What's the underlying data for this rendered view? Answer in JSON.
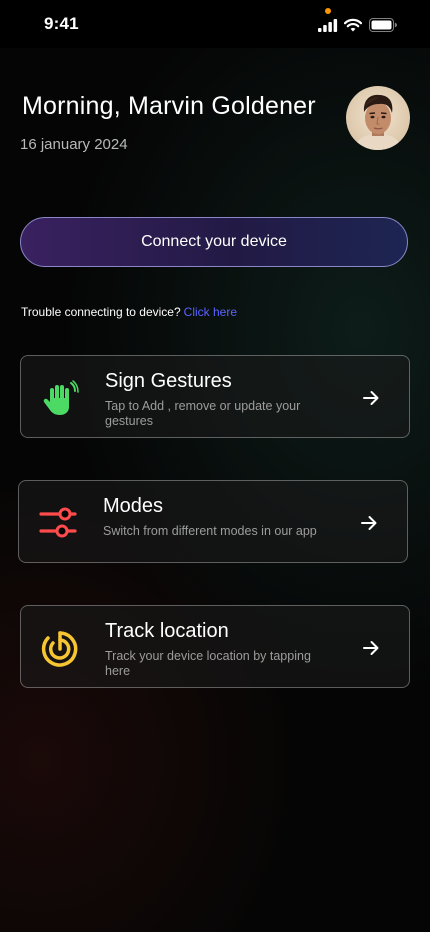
{
  "status_bar": {
    "time": "9:41"
  },
  "header": {
    "greeting": "Morning, Marvin Goldener",
    "date": "16 january 2024"
  },
  "connect": {
    "label": "Connect your device"
  },
  "trouble": {
    "text": "Trouble connecting to device?",
    "link": "Click here",
    "link_color": "#5b63ff"
  },
  "cards": [
    {
      "title": "Sign Gestures",
      "description": "Tap to Add , remove or update your gestures",
      "icon": "hand-gesture-icon",
      "icon_color": "#4cd964"
    },
    {
      "title": "Modes",
      "description": "Switch from different modes in our app",
      "icon": "sliders-icon",
      "icon_color": "#ff4b4b"
    },
    {
      "title": "Track location",
      "description": "Track your device location by tapping here",
      "icon": "location-radar-icon",
      "icon_color": "#f7c531"
    }
  ]
}
